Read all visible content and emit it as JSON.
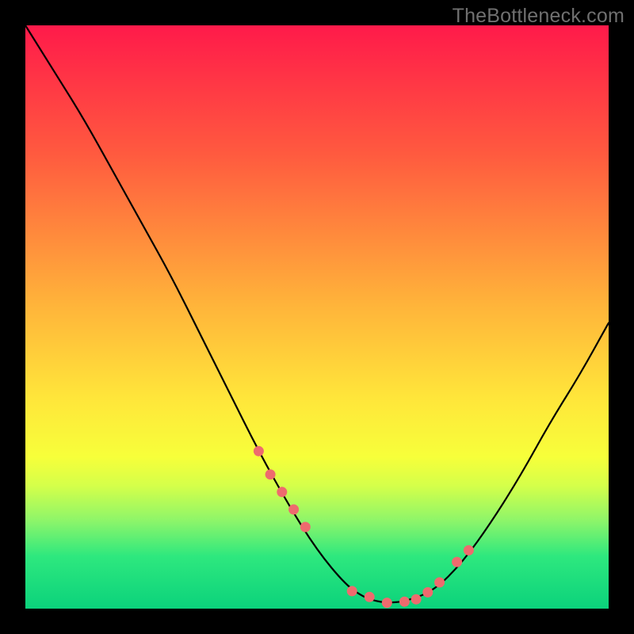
{
  "watermark": "TheBottleneck.com",
  "chart_data": {
    "type": "line",
    "title": "",
    "xlabel": "",
    "ylabel": "",
    "xlim": [
      0,
      100
    ],
    "ylim": [
      0,
      100
    ],
    "grid": false,
    "legend": false,
    "background_gradient": {
      "0": "#ff1a4a",
      "50": "#ffd43a",
      "100": "#0bd27c"
    },
    "series": [
      {
        "name": "bottleneck-curve",
        "x": [
          0,
          5,
          10,
          15,
          20,
          25,
          30,
          35,
          40,
          45,
          50,
          55,
          58,
          60,
          62,
          65,
          70,
          75,
          80,
          85,
          90,
          95,
          100
        ],
        "y": [
          100,
          92,
          84,
          75,
          66,
          57,
          47,
          37,
          27,
          18,
          10,
          4,
          2,
          1.3,
          1,
          1.2,
          3,
          8,
          15,
          23,
          32,
          40,
          49
        ]
      }
    ],
    "markers": {
      "name": "sample-points",
      "color": "#ee6b6e",
      "x": [
        40,
        42,
        44,
        46,
        48,
        56,
        59,
        62,
        65,
        67,
        69,
        71,
        74,
        76
      ],
      "y": [
        27,
        23,
        20,
        17,
        14,
        3,
        2,
        1,
        1.2,
        1.6,
        2.8,
        4.5,
        8,
        10
      ]
    }
  }
}
